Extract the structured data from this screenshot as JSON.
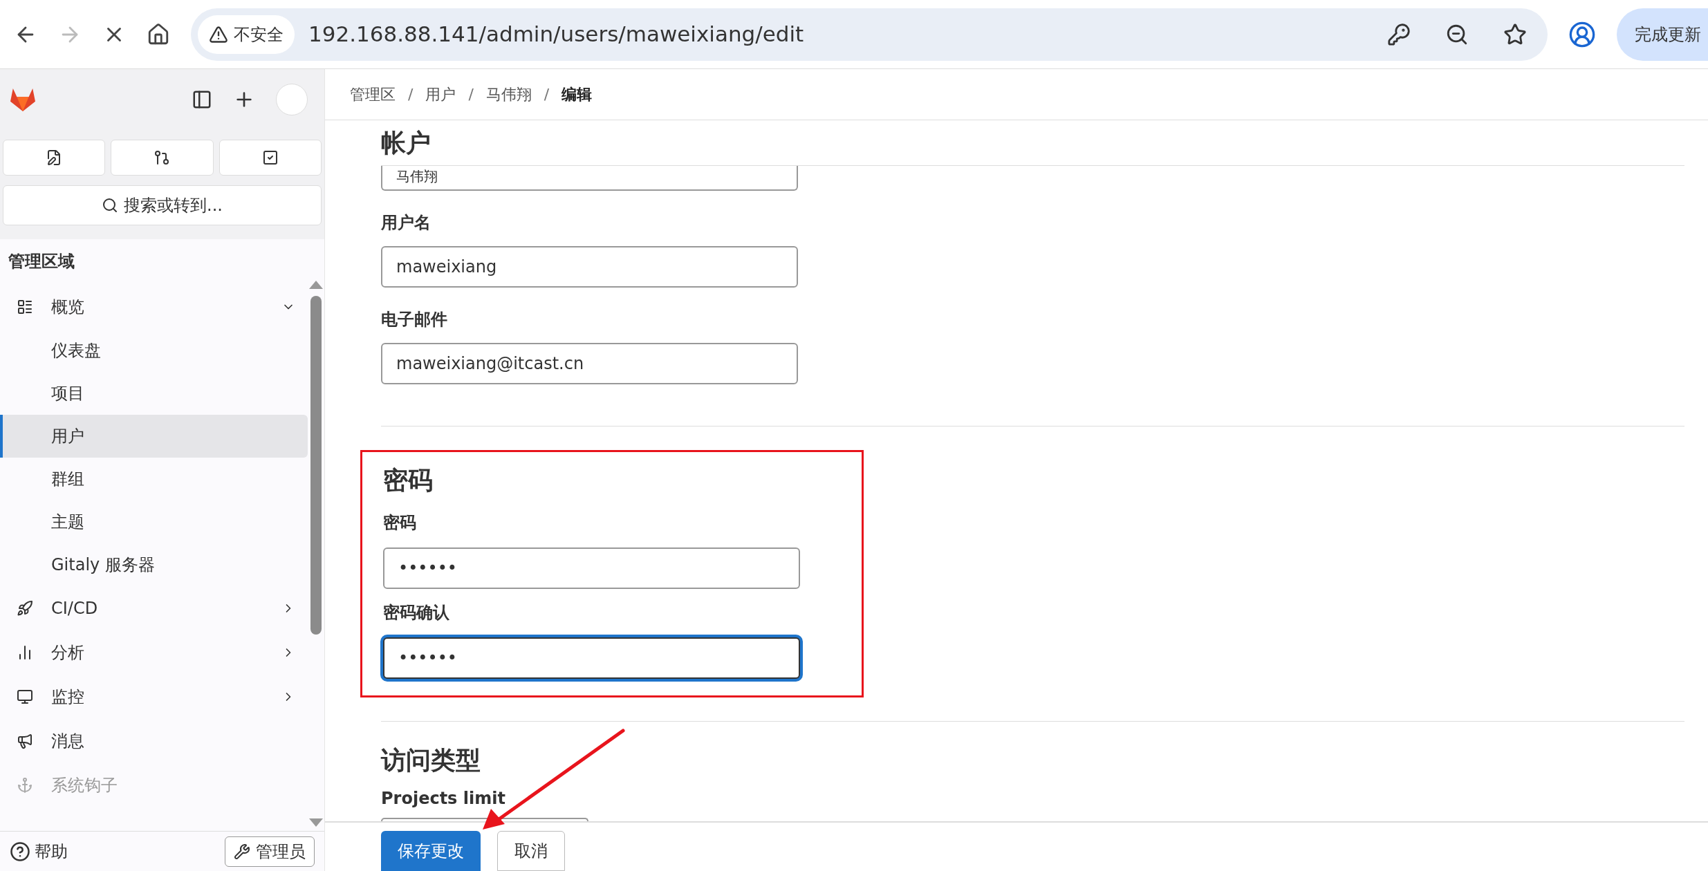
{
  "browser": {
    "security_label": "不安全",
    "url": "192.168.88.141/admin/users/maweixiang/edit",
    "update_button": "完成更新"
  },
  "sidebar": {
    "search_placeholder": "搜索或转到...",
    "section_title": "管理区域",
    "items": [
      {
        "label": "概览",
        "kind": "group",
        "expanded": true,
        "selected": false,
        "disabled": false,
        "children": [
          {
            "label": "仪表盘",
            "selected": false
          },
          {
            "label": "项目",
            "selected": false
          },
          {
            "label": "用户",
            "selected": true
          },
          {
            "label": "群组",
            "selected": false
          },
          {
            "label": "主题",
            "selected": false
          },
          {
            "label": "Gitaly 服务器",
            "selected": false
          }
        ]
      },
      {
        "label": "CI/CD",
        "kind": "group",
        "expanded": false,
        "selected": false,
        "disabled": false
      },
      {
        "label": "分析",
        "kind": "group",
        "expanded": false,
        "selected": false,
        "disabled": false
      },
      {
        "label": "监控",
        "kind": "group",
        "expanded": false,
        "selected": false,
        "disabled": false
      },
      {
        "label": "消息",
        "kind": "link",
        "selected": false,
        "disabled": false
      },
      {
        "label": "系统钩子",
        "kind": "link",
        "selected": false,
        "disabled": true
      }
    ],
    "help": "帮助",
    "admin_button": "管理员"
  },
  "breadcrumb": [
    {
      "label": "管理区",
      "current": false
    },
    {
      "separator": "/",
      "label": "用户",
      "current": false
    },
    {
      "separator": "/",
      "label": "马伟翔",
      "current": false
    },
    {
      "separator": "/",
      "label": "编辑",
      "current": true
    }
  ],
  "account": {
    "title": "帐户",
    "name_value": "马伟翔",
    "fields": [
      {
        "label": "用户名",
        "value": "maweixiang"
      },
      {
        "label": "电子邮件",
        "value": "maweixiang@itcast.cn"
      }
    ]
  },
  "password": {
    "title": "密码",
    "highlighted": true,
    "fields": [
      {
        "label": "密码",
        "value": "••••••",
        "focused": false
      },
      {
        "label": "密码确认",
        "value": "••••••",
        "focused": true
      }
    ]
  },
  "access": {
    "title": "访问类型",
    "field_label": "Projects limit"
  },
  "actions": {
    "save": "保存更改",
    "cancel": "取消"
  }
}
